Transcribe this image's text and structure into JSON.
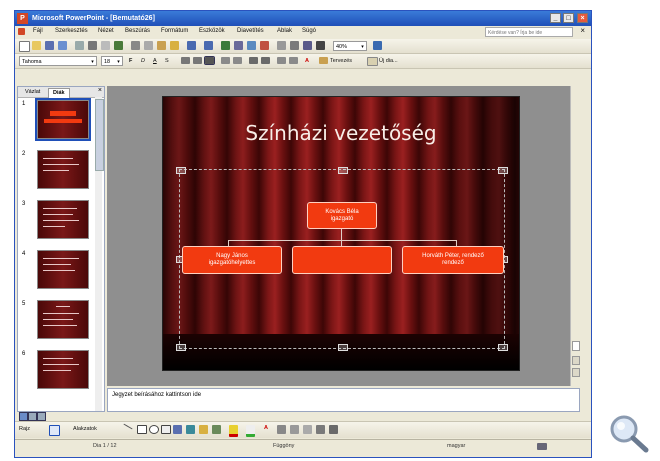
{
  "window": {
    "title": "Microsoft PowerPoint - [Bemutató26]",
    "app_icon_letter": "P",
    "minimize_glyph": "_",
    "restore_glyph": "□",
    "close_glyph": "×"
  },
  "menu": {
    "items": [
      "Fájl",
      "Szerkesztés",
      "Nézet",
      "Beszúrás",
      "Formátum",
      "Eszközök",
      "Diavetítés",
      "Ablak",
      "Súgó"
    ],
    "help_placeholder": "Kérdése van? Írja be ide",
    "doc_close_glyph": "×"
  },
  "standard_toolbar": {
    "zoom": "40%",
    "dropdown_glyph": "▾"
  },
  "format_toolbar": {
    "font": "Tahoma",
    "size": "18",
    "bold": "F",
    "italic": "D",
    "underline": "A",
    "shadow": "S",
    "font_color_glyph": "A",
    "design_label": "Tervezés",
    "new_slide_label": "Új dia..."
  },
  "left_pane": {
    "tabs": [
      "Vázlat",
      "Diák"
    ],
    "active_tab": 1,
    "close_glyph": "×",
    "slides": [
      "1",
      "2",
      "3",
      "4",
      "5",
      "6"
    ]
  },
  "slide": {
    "title": "Színházi vezetőség",
    "boxes": {
      "top": "Kovács Béla\nigazgató",
      "left": "Nagy János\nigazgatóhelyettes",
      "middle": "",
      "right": "Horváth Péter, rendező\nrendező"
    }
  },
  "notes": {
    "text": "Jegyzet beírásához kattintson ide"
  },
  "drawing_toolbar": {
    "draw_label": "Rajz",
    "autoshapes_label": "Alakzatok"
  },
  "status_bar": {
    "slide_count": "Dia 1 / 12",
    "design": "Függöny",
    "language": "magyar"
  },
  "colors": {
    "title_bar": "#1f4fb8",
    "slide_box": "#f23a10",
    "curtain": "#7c1616"
  }
}
